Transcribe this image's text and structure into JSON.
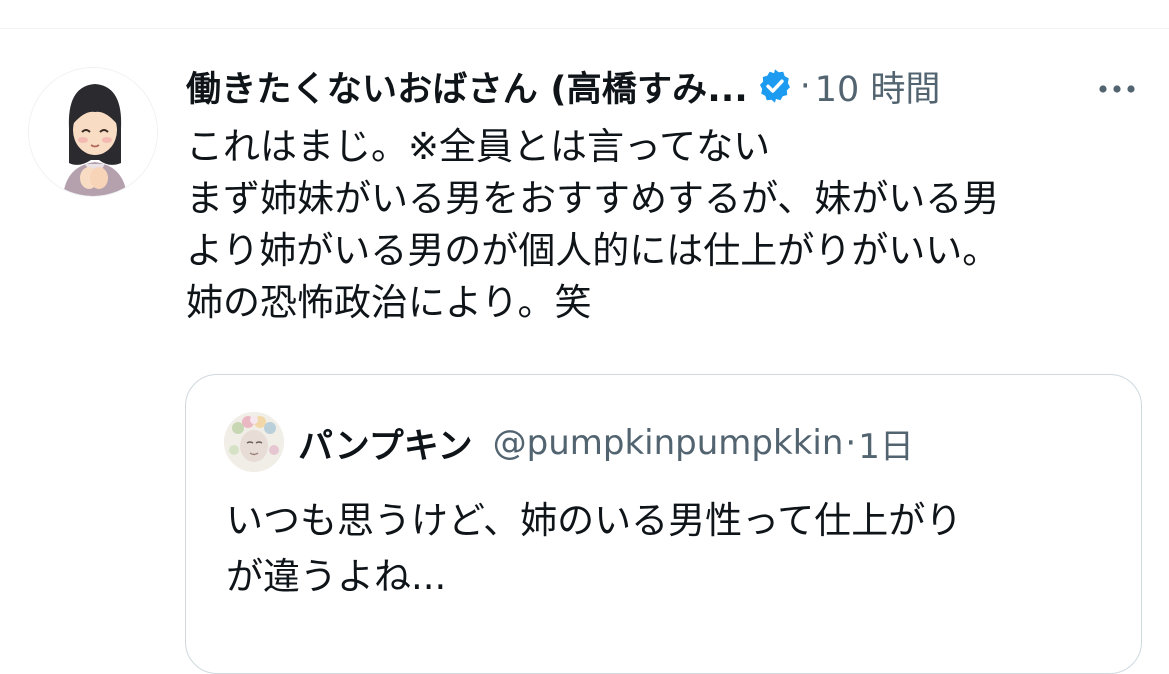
{
  "tweet": {
    "author_name": "働きたくないおばさん (高橋すみ...",
    "separator": "·",
    "timestamp": "10 時間",
    "lines": [
      "これはまじ。※全員とは言ってない",
      "まず姉妹がいる男をおすすめするが、妹がいる男",
      "より姉がいる男のが個人的には仕上がりがいい。",
      "姉の恐怖政治により。笑"
    ],
    "icons": {
      "verified": "verified-badge-icon",
      "more": "more-options-icon"
    }
  },
  "quote": {
    "author_name": "パンプキン",
    "handle": "@pumpkinpumpkkin",
    "separator": "·",
    "timestamp": "1日",
    "lines": [
      "いつも思うけど、姉のいる男性って仕上がり",
      "が違うよね..."
    ]
  },
  "colors": {
    "text_primary": "#0f1419",
    "text_secondary": "#536471",
    "verified_blue": "#1d9bf0",
    "border": "#cfd9de"
  }
}
